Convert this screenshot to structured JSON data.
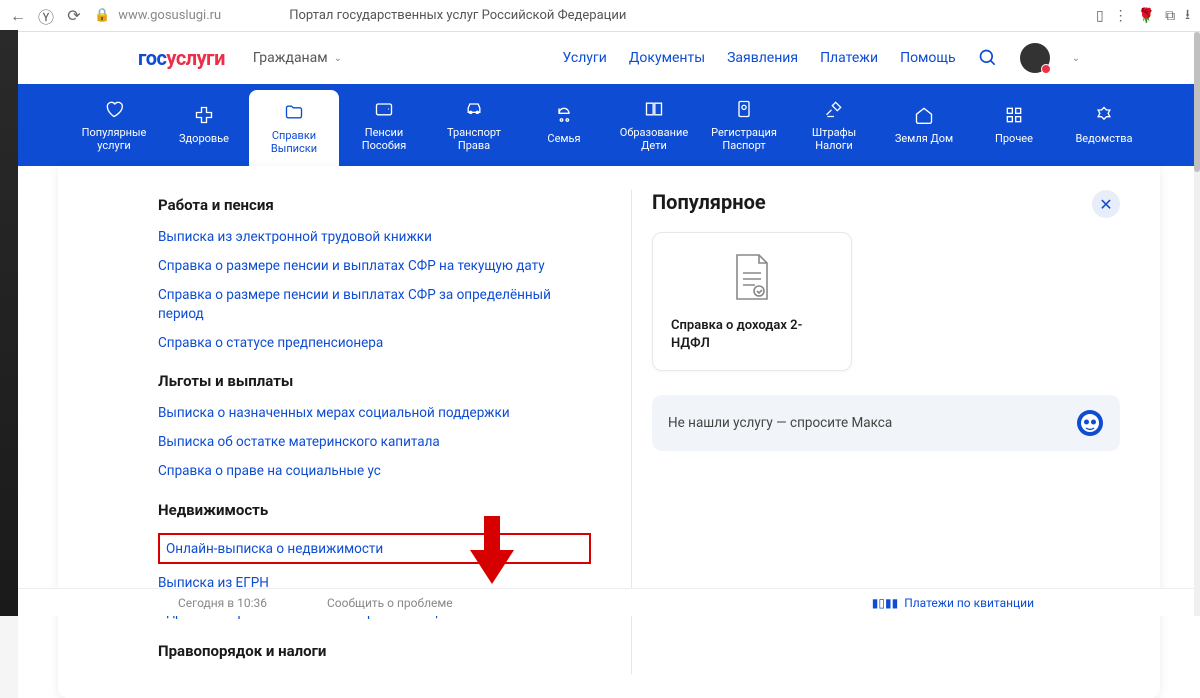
{
  "browser": {
    "url": "www.gosuslugi.ru",
    "title": "Портал государственных услуг Российской Федерации"
  },
  "logo": {
    "part1": "гос",
    "part2": "услуги"
  },
  "audience": "Гражданам",
  "topnav": {
    "services": "Услуги",
    "documents": "Документы",
    "applications": "Заявления",
    "payments": "Платежи",
    "help": "Помощь"
  },
  "categories": [
    {
      "label": "Популярные услуги"
    },
    {
      "label": "Здоровье"
    },
    {
      "label": "Справки Выписки"
    },
    {
      "label": "Пенсии Пособия"
    },
    {
      "label": "Транспорт Права"
    },
    {
      "label": "Семья"
    },
    {
      "label": "Образование Дети"
    },
    {
      "label": "Регистрация Паспорт"
    },
    {
      "label": "Штрафы Налоги"
    },
    {
      "label": "Земля Дом"
    },
    {
      "label": "Прочее"
    },
    {
      "label": "Ведомства"
    }
  ],
  "sections": {
    "work_pension": {
      "title": "Работа и пенсия",
      "links": [
        "Выписка из электронной трудовой книжки",
        "Справка о размере пенсии и выплатах СФР на текущую дату",
        "Справка о размере пенсии и выплатах СФР за определённый период",
        "Справка о статусе предпенсионера"
      ]
    },
    "benefits": {
      "title": "Льготы и выплаты",
      "links": [
        "Выписка о назначенных мерах социальной поддержки",
        "Выписка об остатке материнского капитала",
        "Справка о праве на социальные ус"
      ]
    },
    "realestate": {
      "title": "Недвижимость",
      "links": [
        "Онлайн-выписка о недвижимости",
        "Выписка из ЕГРН",
        "Адресная справка и выписка о проживающих"
      ]
    },
    "law_taxes": {
      "title": "Правопорядок и налоги"
    }
  },
  "popular": {
    "title": "Популярное",
    "card_label": "Справка о доходах 2-НДФЛ"
  },
  "max_prompt": "Не нашли услугу — спросите Макса",
  "footer": {
    "today": "Сегодня в 10:36",
    "report": "Сообщить о проблеме",
    "pay": "Платежи по квитанции"
  }
}
